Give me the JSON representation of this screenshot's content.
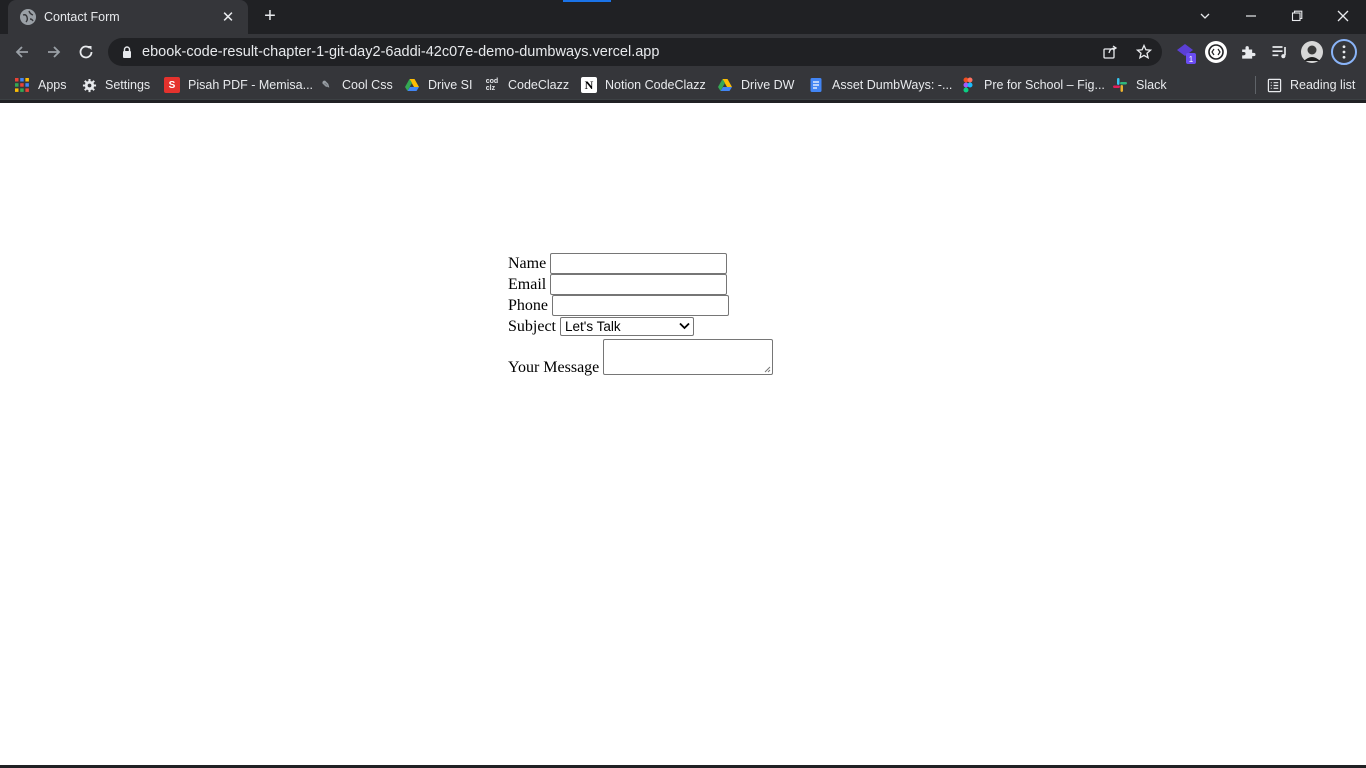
{
  "browser": {
    "tab": {
      "title": "Contact Form"
    },
    "address_bar": {
      "url": "ebook-code-result-chapter-1-git-day2-6addi-42c07e-demo-dumbways.vercel.app"
    },
    "extension_badge": "1",
    "bookmarks": [
      {
        "label": "Apps",
        "icon": "apps-grid-icon"
      },
      {
        "label": "Settings",
        "icon": "gear-icon"
      },
      {
        "label": "Pisah PDF - Memisa...",
        "icon": "pdf-s-icon",
        "color": "#e5322d"
      },
      {
        "label": "Cool Css",
        "icon": "coolcss-icon"
      },
      {
        "label": "Drive SI",
        "icon": "google-drive-icon"
      },
      {
        "label": "CodeClazz",
        "icon": "codeclazz-icon"
      },
      {
        "label": "Notion CodeClazz",
        "icon": "notion-icon"
      },
      {
        "label": "Drive DW",
        "icon": "google-drive-icon"
      },
      {
        "label": "Asset DumbWays: -...",
        "icon": "google-docs-icon",
        "color": "#4285f4"
      },
      {
        "label": "Pre for School – Fig...",
        "icon": "figma-icon"
      },
      {
        "label": "Slack",
        "icon": "slack-icon"
      }
    ],
    "reading_list": {
      "label": "Reading list",
      "icon": "reading-list-icon"
    }
  },
  "form": {
    "name_label": "Name",
    "name_value": "",
    "email_label": "Email",
    "email_value": "",
    "phone_label": "Phone",
    "phone_value": "",
    "subject_label": "Subject",
    "subject_selected": "Let's Talk",
    "message_label": "Your Message",
    "message_value": ""
  }
}
